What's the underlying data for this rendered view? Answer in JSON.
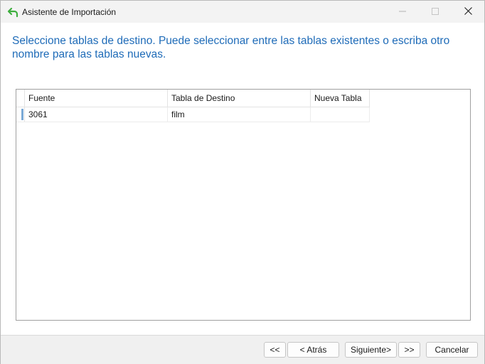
{
  "window": {
    "title": "Asistente de Importación",
    "icon": "undo-arrow-icon",
    "controls": [
      "minimize-icon",
      "maximize-icon",
      "close-icon"
    ]
  },
  "instructions": "Seleccione tablas de destino. Puede seleccionar entre las tablas existentes o escriba otro nombre para las tablas nuevas.",
  "grid": {
    "columns": [
      "Fuente",
      "Tabla de Destino",
      "Nueva Tabla"
    ],
    "rows": [
      {
        "source": "3061",
        "target": "film",
        "new_table": ""
      }
    ]
  },
  "footer": {
    "first_label": "<<",
    "back_label": "< Atrás",
    "next_label": "Siguiente>",
    "last_label": ">>",
    "cancel_label": "Cancelar"
  },
  "colors": {
    "heading": "#1e6bb8",
    "row_marker": "#7aa9d6",
    "icon_green": "#3fae3f"
  }
}
